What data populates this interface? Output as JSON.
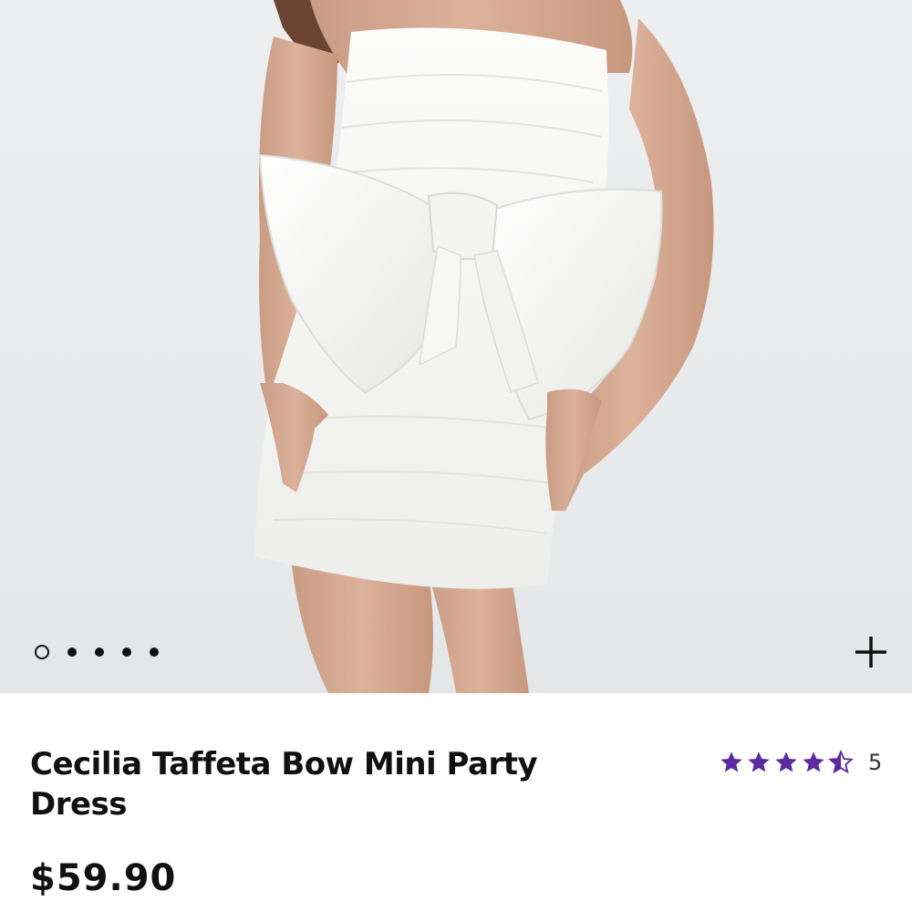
{
  "product": {
    "title": "Cecilia Taffeta Bow Mini Party Dress",
    "price": "$59.90",
    "rating": {
      "value": 4.5,
      "max": 5,
      "count": "5",
      "color": "#5b2a9e"
    }
  },
  "gallery": {
    "image_alt": "Model wearing white strapless mini dress with oversized bow",
    "total_images": 5,
    "active_index": 0,
    "zoom_icon": "plus-icon"
  }
}
